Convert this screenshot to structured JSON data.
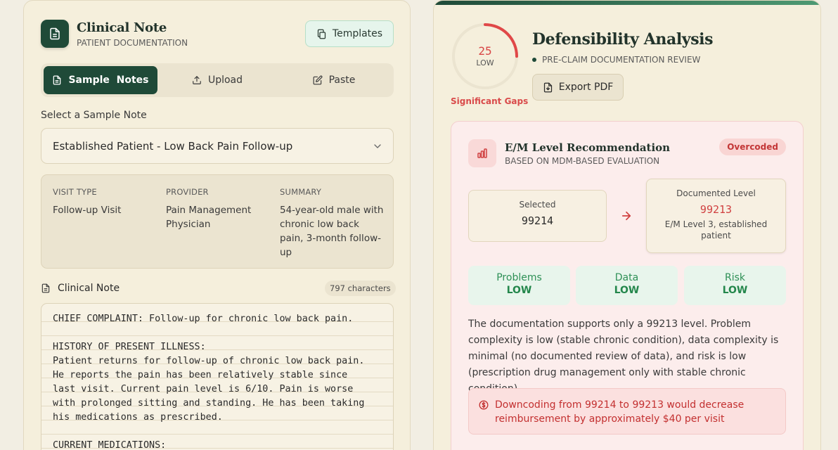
{
  "header": {
    "title": "Clinical Note",
    "subtitle": "PATIENT DOCUMENTATION",
    "templates_label": "Templates"
  },
  "tabs": [
    {
      "label": "Sample  Notes",
      "icon": "document-icon",
      "active": true
    },
    {
      "label": "Upload",
      "icon": "upload-icon",
      "active": false
    },
    {
      "label": "Paste",
      "icon": "edit-icon",
      "active": false
    }
  ],
  "sample_select": {
    "label": "Select a Sample Note",
    "value": "Established Patient - Low Back Pain Follow-up"
  },
  "visit_info": {
    "visit_type_label": "VISIT TYPE",
    "visit_type": "Follow-up Visit",
    "provider_label": "PROVIDER",
    "provider": "Pain Management Physician",
    "summary_label": "SUMMARY",
    "summary": "54-year-old male with chronic low back pain, 3-month follow-up"
  },
  "clinical_note": {
    "title": "Clinical Note",
    "char_count": "797 characters",
    "text": "CHIEF COMPLAINT: Follow-up for chronic low back pain.\n\nHISTORY OF PRESENT ILLNESS:\nPatient returns for follow-up of chronic low back pain.\nHe reports the pain has been relatively stable since\nlast visit. Current pain level is 6/10. Pain is worse\nwith prolonged sitting and standing. He has been taking\nhis medications as prescribed.\n\nCURRENT MEDICATIONS:"
  },
  "analysis": {
    "score": "25",
    "score_value": 25,
    "score_level": "LOW",
    "score_status": "Significant Gaps",
    "title": "Defensibility Analysis",
    "subtitle": "PRE-CLAIM DOCUMENTATION REVIEW",
    "export_label": "Export PDF"
  },
  "em": {
    "title": "E/M Level Recommendation",
    "subtitle": "BASED ON MDM-BASED EVALUATION",
    "badge": "Overcoded",
    "selected_label": "Selected",
    "selected_code": "99214",
    "documented_label": "Documented Level",
    "documented_code": "99213",
    "documented_desc": "E/M Level 3, established patient",
    "metrics": [
      {
        "label": "Problems",
        "value": "LOW"
      },
      {
        "label": "Data",
        "value": "LOW"
      },
      {
        "label": "Risk",
        "value": "LOW"
      }
    ],
    "description": "The documentation supports only a 99213 level. Problem complexity is low (stable chronic condition), data complexity is minimal (no documented review of data), and risk is low (prescription drug management only with stable chronic condition).",
    "warning": "Downcoding from 99214 to 99213 would decrease reimbursement by approximately $40 per visit"
  },
  "colors": {
    "brand": "#1f4a38",
    "danger": "#d84545",
    "success": "#24874c"
  }
}
